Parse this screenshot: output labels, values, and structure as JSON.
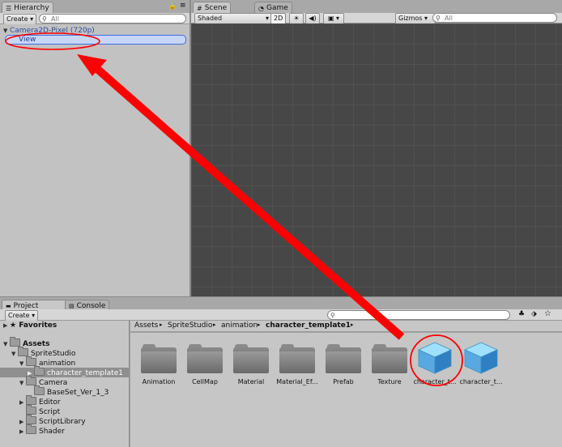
{
  "hierarchy": {
    "tab_label": "Hierarchy",
    "create_label": "Create",
    "search_placeholder": "All",
    "root_item": "Camera2D-Pixel (720p)",
    "child_item": "View"
  },
  "scene": {
    "tabs": [
      "Scene",
      "Game"
    ],
    "shading_mode": "Shaded",
    "mode_2d_label": "2D",
    "gizmos_label": "Gizmos",
    "search_placeholder": "All"
  },
  "project": {
    "tabs": [
      "Project",
      "Console"
    ],
    "create_label": "Create",
    "favorites_label": "Favorites",
    "tree": [
      {
        "label": "Assets",
        "bold": true
      },
      {
        "label": "SpriteStudio"
      },
      {
        "label": "animation"
      },
      {
        "label": "character_template1"
      },
      {
        "label": "Camera"
      },
      {
        "label": "BaseSet_Ver_1_3"
      },
      {
        "label": "Editor"
      },
      {
        "label": "Script"
      },
      {
        "label": "ScriptLibrary"
      },
      {
        "label": "Shader"
      }
    ],
    "breadcrumb": [
      "Assets",
      "SpriteStudio",
      "animation",
      "character_template1"
    ],
    "assets": [
      {
        "label": "Animation",
        "kind": "folder"
      },
      {
        "label": "CellMap",
        "kind": "folder"
      },
      {
        "label": "Material",
        "kind": "folder"
      },
      {
        "label": "Material_Ef...",
        "kind": "folder"
      },
      {
        "label": "Prefab",
        "kind": "folder"
      },
      {
        "label": "Texture",
        "kind": "folder"
      },
      {
        "label": "character_t...",
        "kind": "prefab"
      },
      {
        "label": "character_t...",
        "kind": "prefab"
      }
    ]
  },
  "colors": {
    "annotation": "#ff0000",
    "selection": "#3d6ee8",
    "scene_bg": "#474747"
  }
}
